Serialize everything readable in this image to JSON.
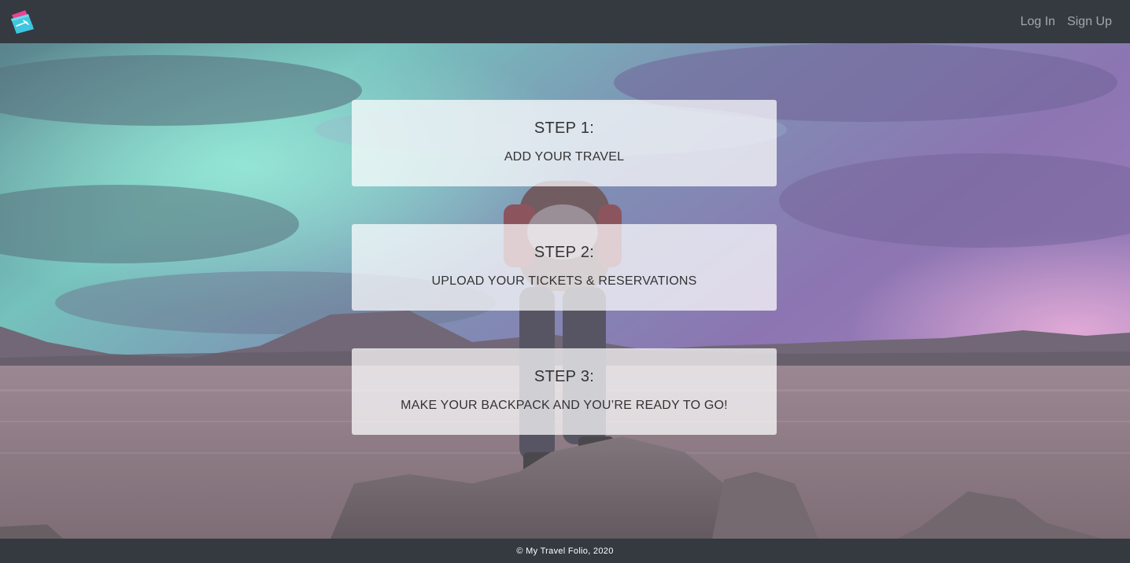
{
  "navbar": {
    "logo_icon": "travel-folio-logo-icon",
    "links": {
      "login": "Log In",
      "signup": "Sign Up"
    }
  },
  "steps": [
    {
      "title": "STEP 1:",
      "description": "ADD YOUR TRAVEL"
    },
    {
      "title": "STEP 2:",
      "description": "UPLOAD YOUR TICKETS & RESERVATIONS"
    },
    {
      "title": "STEP 3:",
      "description": "MAKE YOUR BACKPACK AND YOU’RE READY TO GO!"
    }
  ],
  "footer": {
    "copyright": "© My Travel Folio, 2020"
  },
  "colors": {
    "navbar_bg": "#343a40",
    "nav_link": "rgba(255,255,255,0.55)",
    "card_bg": "rgba(255,255,255,0.72)",
    "logo_pink": "#e84393",
    "logo_blue": "#3ec6e0"
  }
}
